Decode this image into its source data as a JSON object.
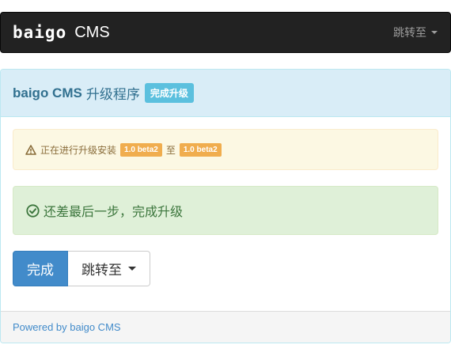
{
  "navbar": {
    "logo_text": "baigo",
    "brand_suffix": "CMS",
    "jump_label": "跳转至"
  },
  "panel": {
    "heading": {
      "product": "baigo CMS",
      "title": "升级程序",
      "badge": "完成升级"
    },
    "warning": {
      "icon": "warning-triangle-icon",
      "text_before": "正在进行升级安装",
      "from_version": "1.0 beta2",
      "connector": "至",
      "to_version": "1.0 beta2"
    },
    "success": {
      "icon": "check-circle-icon",
      "text": "还差最后一步，完成升级"
    },
    "actions": {
      "finish_label": "完成",
      "jump_label": "跳转至"
    },
    "footer": {
      "powered_by": "Powered by baigo CMS"
    }
  },
  "colors": {
    "navbar_bg": "#222222",
    "panel_info_bg": "#d9edf7",
    "info_badge": "#5bc0de",
    "warning_label": "#f0ad4e",
    "success_bg": "#dff0d8",
    "primary": "#428bca"
  }
}
